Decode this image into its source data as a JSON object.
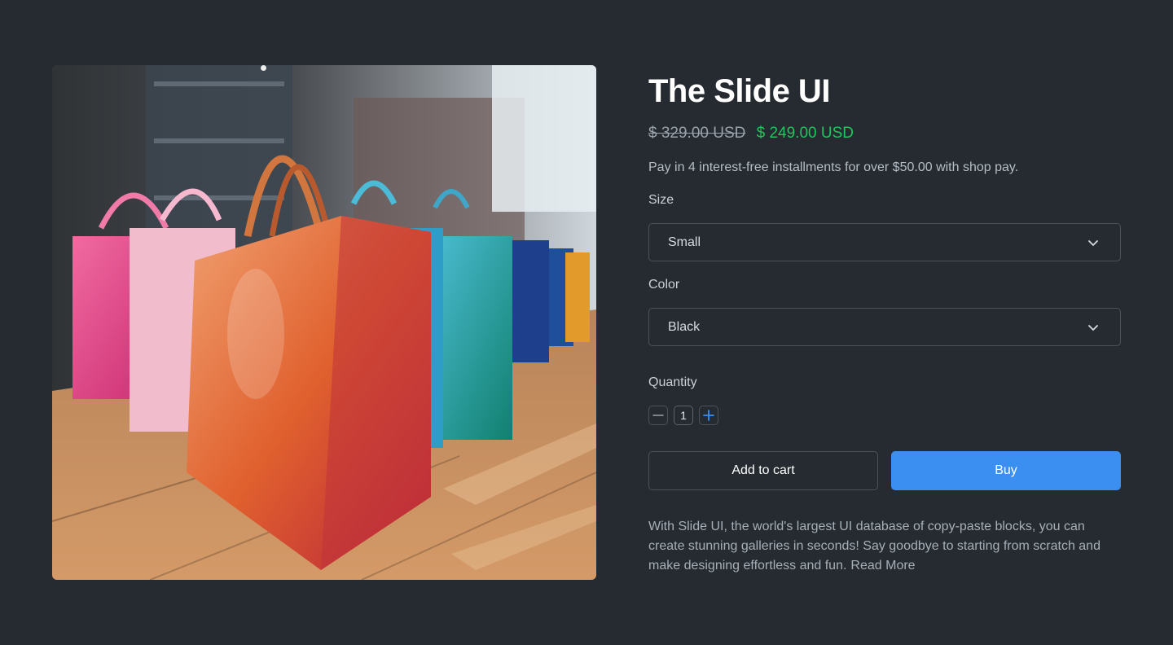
{
  "product": {
    "title": "The Slide UI",
    "image_alt": "Row of glossy colorful shopping bags in a store",
    "price_original": "$ 329.00 USD",
    "price_sale": "$ 249.00 USD",
    "installments_text": "Pay in 4 interest-free installments for over $50.00 with shop pay."
  },
  "options": {
    "size": {
      "label": "Size",
      "value": "Small",
      "icon": "chevron-down-icon"
    },
    "color": {
      "label": "Color",
      "value": "Black",
      "icon": "chevron-down-icon"
    }
  },
  "quantity": {
    "label": "Quantity",
    "value": "1",
    "decrement_icon": "minus-icon",
    "increment_icon": "plus-icon"
  },
  "actions": {
    "add_to_cart_label": "Add to cart",
    "buy_label": "Buy"
  },
  "description": {
    "text": "With Slide UI, the world's largest UI database of copy-paste blocks, you can create stunning galleries in seconds! Say goodbye to starting from scratch and make designing effortless and fun.",
    "read_more_label": "Read More"
  },
  "colors": {
    "background": "#252b30",
    "sale_price": "#22c55e",
    "primary": "#3b8ff0",
    "border": "#4a535b"
  }
}
